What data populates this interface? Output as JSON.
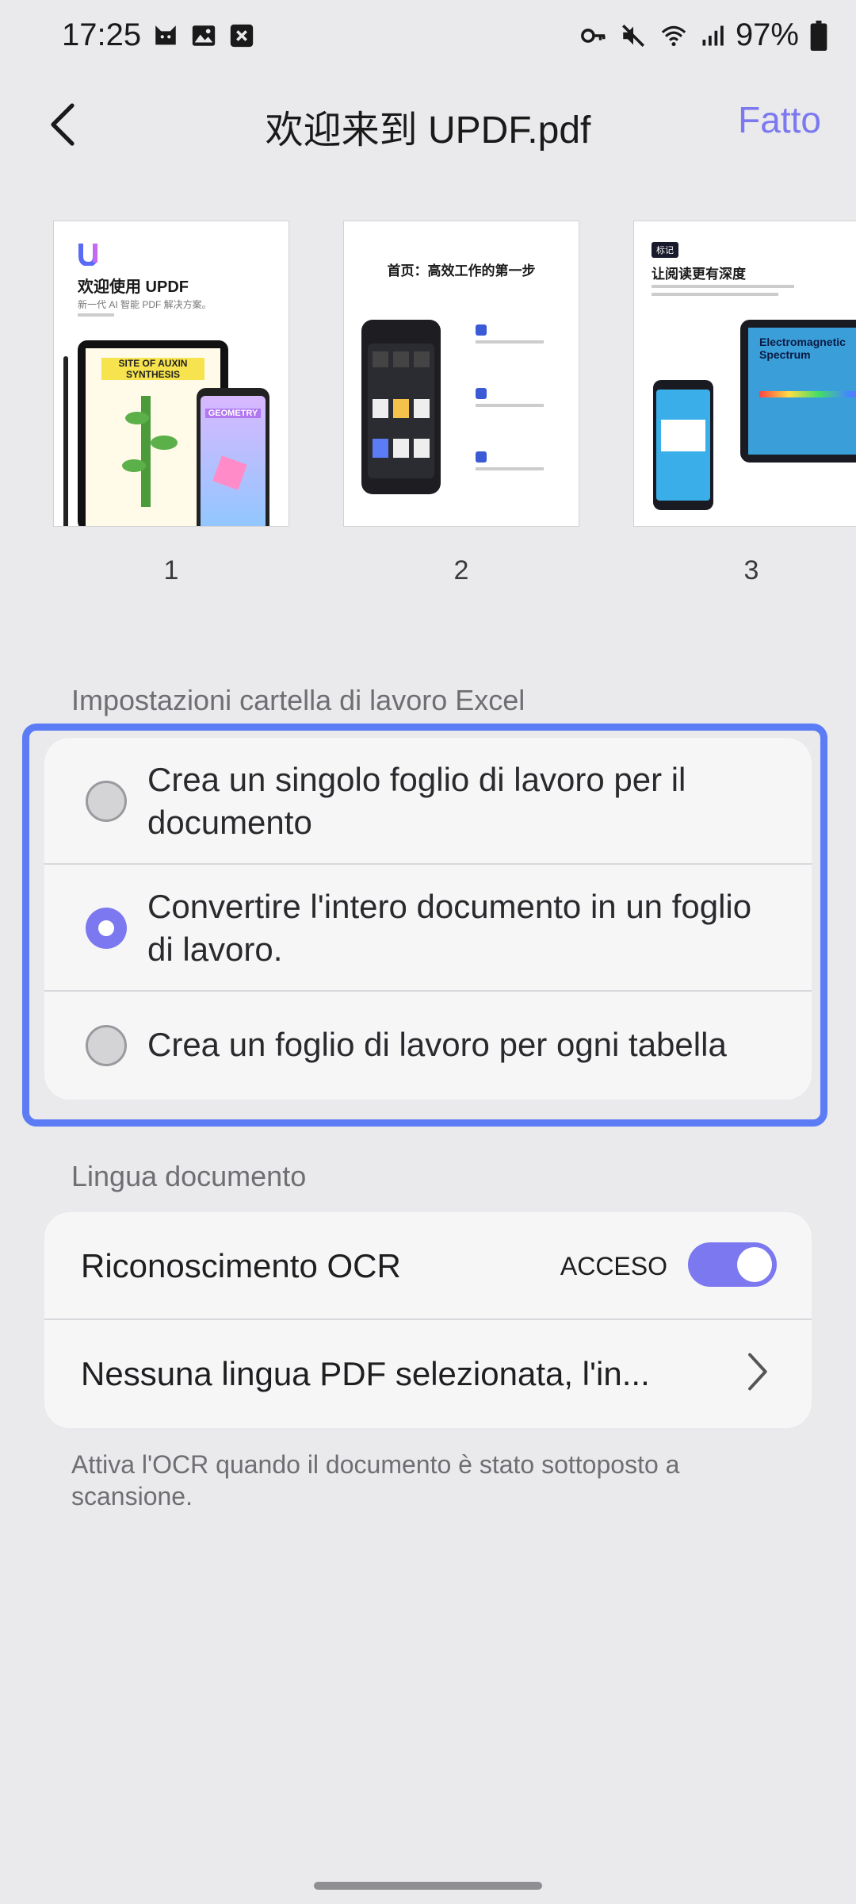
{
  "status_bar": {
    "time": "17:25",
    "battery": "97%",
    "icons": [
      "cat-icon",
      "image-icon",
      "close-box-icon",
      "key-icon",
      "mute-icon",
      "wifi-icon",
      "signal-icon",
      "battery-icon"
    ]
  },
  "header": {
    "title": "欢迎来到 UPDF.pdf",
    "done_label": "Fatto"
  },
  "thumbnails": [
    {
      "page": "1",
      "title": "欢迎使用 UPDF",
      "subtitle": "新一代 AI 智能 PDF 解决方案。",
      "poster": "SITE OF AUXIN SYNTHESIS",
      "tag": "GEOMETRY"
    },
    {
      "page": "2",
      "title": "首页：高效工作的第一步"
    },
    {
      "page": "3",
      "tag": "标记",
      "title": "让阅读更有深度",
      "poster": "Electromagnetic Spectrum"
    }
  ],
  "excel_section": {
    "label": "Impostazioni cartella di lavoro Excel",
    "options": [
      {
        "text": "Crea un singolo foglio di lavoro per il documento",
        "selected": false
      },
      {
        "text": "Convertire l'intero documento in un foglio di lavoro.",
        "selected": true
      },
      {
        "text": "Crea un foglio di lavoro per ogni tabella",
        "selected": false
      }
    ]
  },
  "language_section": {
    "label": "Lingua documento",
    "ocr_label": "Riconoscimento OCR",
    "ocr_state": "ACCESO",
    "ocr_enabled": true,
    "language_value": "Nessuna lingua PDF selezionata, l'in..."
  },
  "hint": "Attiva l'OCR quando il documento è stato sottoposto a scansione.",
  "colors": {
    "accent": "#7b78f0",
    "highlight_border": "#5b7cf5",
    "background": "#eaeaec"
  }
}
